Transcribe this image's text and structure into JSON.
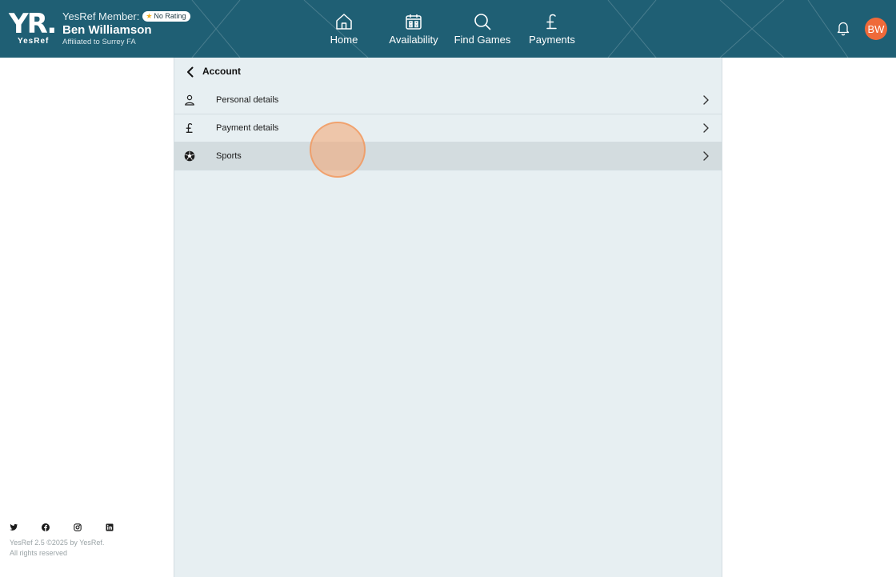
{
  "brand": {
    "logo_text": "YR.",
    "logo_sub": "YesRef"
  },
  "member": {
    "label": "YesRef Member:",
    "rating_badge": "No Rating",
    "name": "Ben Williamson",
    "affiliation": "Affiliated to Surrey FA"
  },
  "nav": [
    {
      "label": "Home",
      "icon": "home-icon"
    },
    {
      "label": "Availability",
      "icon": "calendar-icon"
    },
    {
      "label": "Find Games",
      "icon": "search-icon"
    },
    {
      "label": "Payments",
      "icon": "pound-icon"
    }
  ],
  "avatar_initials": "BW",
  "account": {
    "title": "Account",
    "items": [
      {
        "label": "Personal details",
        "icon": "person-icon"
      },
      {
        "label": "Payment details",
        "icon": "pound-icon"
      },
      {
        "label": "Sports",
        "icon": "football-icon"
      }
    ]
  },
  "footer": {
    "version_line": "YesRef 2.5 ©2025 by YesRef.",
    "rights": "All rights reserved"
  },
  "colors": {
    "header": "#1f5f74",
    "panel": "#e7eff2",
    "accent": "#ef6a3a"
  }
}
